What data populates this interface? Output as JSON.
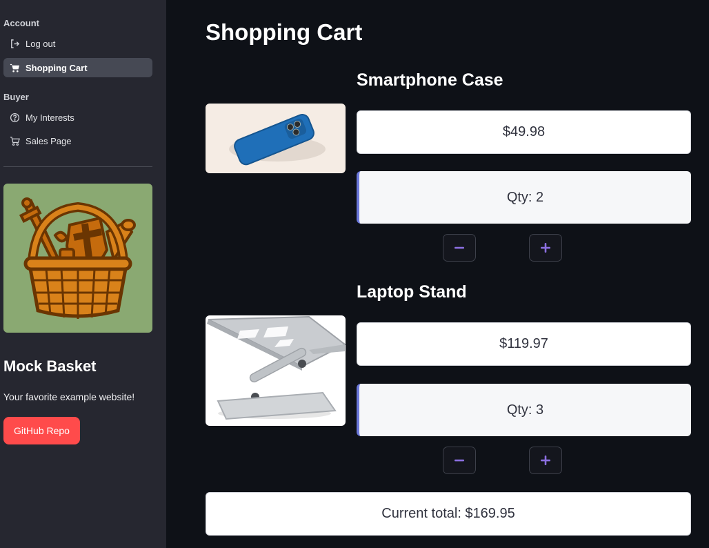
{
  "sidebar": {
    "sections": [
      {
        "heading": "Account",
        "items": [
          {
            "label": "Log out",
            "icon": "logout-icon",
            "active": false
          },
          {
            "label": "Shopping Cart",
            "icon": "cart-icon",
            "active": true
          }
        ]
      },
      {
        "heading": "Buyer",
        "items": [
          {
            "label": "My Interests",
            "icon": "help-circle-icon",
            "active": false
          },
          {
            "label": "Sales Page",
            "icon": "cart-icon",
            "active": false
          }
        ]
      }
    ],
    "brand": {
      "title": "Mock Basket",
      "tagline": "Your favorite example website!",
      "repo_button": "GitHub Repo",
      "logo_icon": "basket-logo-icon"
    }
  },
  "main": {
    "title": "Shopping Cart",
    "items": [
      {
        "name": "Smartphone Case",
        "price": "$49.98",
        "qty": "Qty: 2",
        "image_icon": "phone-case-image"
      },
      {
        "name": "Laptop Stand",
        "price": "$119.97",
        "qty": "Qty: 3",
        "image_icon": "laptop-stand-image"
      }
    ],
    "total": "Current total: $169.95"
  },
  "colors": {
    "background": "#0e1117",
    "sidebar": "#262730",
    "accent": "#ff4b4b",
    "qty_border": "#6b78db",
    "stepper_icon": "#8b6fe0"
  }
}
